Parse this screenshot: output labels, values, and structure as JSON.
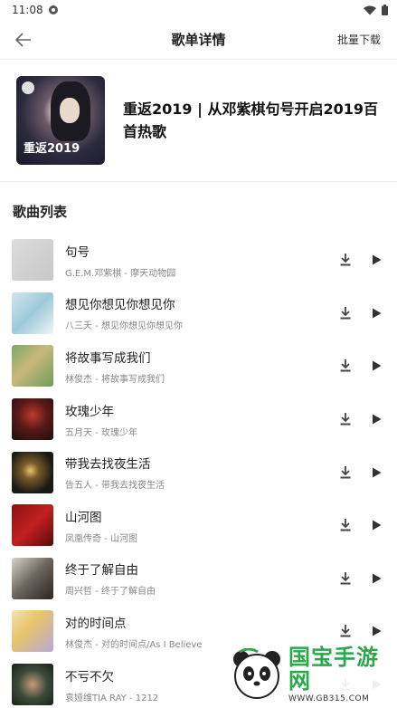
{
  "status_bar": {
    "time": "11:08"
  },
  "app_bar": {
    "title": "歌单详情",
    "batch_download": "批量下载"
  },
  "playlist": {
    "cover_text": "重返2019",
    "title": "重返2019 | 从邓紫棋句号开启2019百首热歌"
  },
  "section": {
    "title": "歌曲列表"
  },
  "songs": [
    {
      "name": "句号",
      "sub": "G.E.M.邓紫棋 - 摩天动物园",
      "thumb": "linear-gradient(135deg,#dcdcdc,#c8c8c8)"
    },
    {
      "name": "想见你想见你想见你",
      "sub": "八三夭 - 想见你想见你想见你",
      "thumb": "linear-gradient(135deg,#cfe6ee 0%,#9ec9d8 50%,#eef6f8 100%)"
    },
    {
      "name": "将故事写成我们",
      "sub": "林俊杰 - 将故事写成我们",
      "thumb": "linear-gradient(135deg,#7ba86a 0%,#c9b87a 45%,#6f9c5c 100%)"
    },
    {
      "name": "玫瑰少年",
      "sub": "五月天 - 玫瑰少年",
      "thumb": "radial-gradient(circle at 50% 40%,#c0392b 0%,#5a1a18 45%,#1a1010 100%)"
    },
    {
      "name": "带我去找夜生活",
      "sub": "告五人 - 带我去找夜生活",
      "thumb": "radial-gradient(circle at 45% 45%,#e6c46a 0%,#7a5c2a 25%,#1a1a14 70%)"
    },
    {
      "name": "山河图",
      "sub": "凤凰传奇 - 山河图",
      "thumb": "linear-gradient(135deg,#8c1010 0%,#c42020 50%,#5a0a0a 100%)"
    },
    {
      "name": "终于了解自由",
      "sub": "周兴哲 - 终于了解自由",
      "thumb": "linear-gradient(135deg,#d8d4cc 0%,#6a625a 50%,#2a2622 100%)"
    },
    {
      "name": "对的时间点",
      "sub": "林俊杰 - 对的时间点/As I Believe",
      "thumb": "linear-gradient(135deg,#f3e2b0 0%,#e8c46a 40%,#b8a8d8 100%)"
    },
    {
      "name": "不亏不欠",
      "sub": "袁娅维TIA RAY - 1212",
      "thumb": "radial-gradient(circle at 50% 50%,#c89a7a 0%,#3a4a3a 50%,#1a2218 100%)"
    }
  ],
  "watermark": {
    "brand": "国宝手游网",
    "url": "WWW.GB315.COM"
  }
}
